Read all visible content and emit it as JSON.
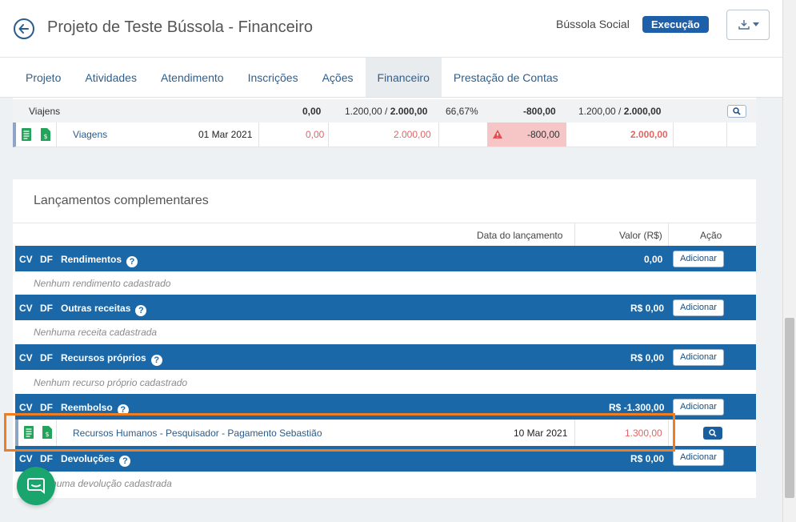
{
  "header": {
    "title": "Projeto de Teste Bússola - Financeiro",
    "org": "Bússola Social",
    "status": "Execução"
  },
  "tabs": [
    {
      "label": "Projeto"
    },
    {
      "label": "Atividades"
    },
    {
      "label": "Atendimento"
    },
    {
      "label": "Inscrições"
    },
    {
      "label": "Ações"
    },
    {
      "label": "Financeiro"
    },
    {
      "label": "Prestação de Contas"
    }
  ],
  "budget": {
    "group": {
      "name": "Viajens",
      "value1": "0,00",
      "partial_a": "1.200,00 / ",
      "partial_b": "2.000,00",
      "percent": "66,67%",
      "diff": "-800,00",
      "partial2_a": "1.200,00 / ",
      "partial2_b": "2.000,00"
    },
    "item": {
      "name": "Viagens",
      "date": "01 Mar 2021",
      "value": "0,00",
      "planned": "2.000,00",
      "diff": "-800,00",
      "total": "2.000,00"
    }
  },
  "complementary": {
    "title": "Lançamentos complementares",
    "columns": {
      "date": "Data do lançamento",
      "value": "Valor (R$)",
      "action": "Ação"
    },
    "add_label": "Adicionar",
    "sections": [
      {
        "name": "Rendimentos",
        "total": "0,00",
        "empty": "Nenhum rendimento cadastrado"
      },
      {
        "name": "Outras receitas",
        "total": "R$ 0,00",
        "empty": "Nenhuma receita cadastrada"
      },
      {
        "name": "Recursos próprios",
        "total": "R$ 0,00",
        "empty": "Nenhum recurso próprio cadastrado"
      },
      {
        "name": "Reembolso",
        "total": "R$ -1.300,00"
      },
      {
        "name": "Devoluções",
        "total": "R$ 0,00",
        "empty": "Nenhuma devolução cadastrada"
      }
    ],
    "cv": "CV",
    "df": "DF",
    "reembolso_item": {
      "name": "Recursos Humanos - Pesquisador - Pagamento Sebastião",
      "date": "10 Mar 2021",
      "value": "1.300,00"
    }
  },
  "colors": {
    "primary": "#1b68a8",
    "accent": "#ef7d22",
    "chat": "#1aa56f",
    "negative": "#e06666"
  }
}
